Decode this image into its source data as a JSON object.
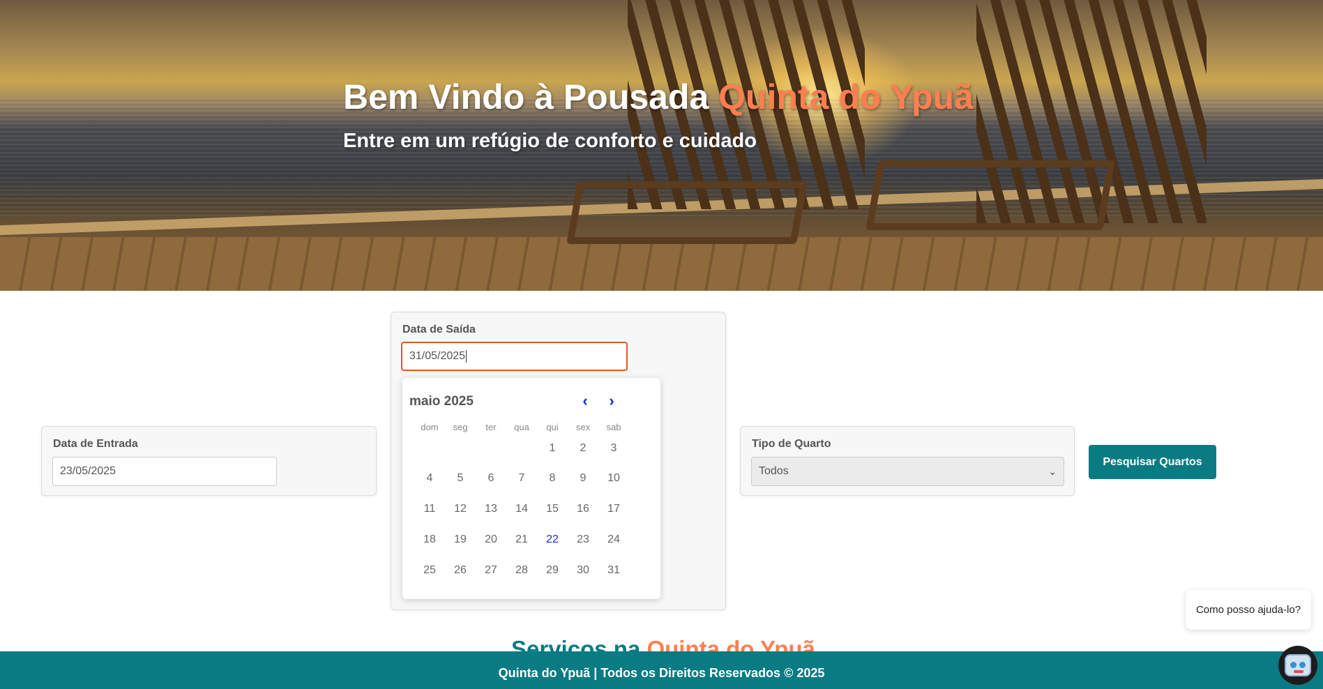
{
  "hero": {
    "title_prefix": "Bem Vindo à Pousada ",
    "title_accent": "Quinta do Ypuã",
    "subtitle": "Entre em um refúgio de conforto e cuidado"
  },
  "search": {
    "checkin": {
      "label": "Data de Entrada",
      "value": "23/05/2025"
    },
    "checkout": {
      "label": "Data de Saída",
      "value": "31/05/2025"
    },
    "room_type": {
      "label": "Tipo de Quarto",
      "selected": "Todos"
    },
    "button_label": "Pesquisar Quartos"
  },
  "datepicker": {
    "month_label": "maio 2025",
    "prev_icon": "chevron-left-icon",
    "next_icon": "chevron-right-icon",
    "weekdays": [
      "dom",
      "seg",
      "ter",
      "qua",
      "qui",
      "sex",
      "sab"
    ],
    "weeks": [
      [
        "",
        "",
        "",
        "",
        "1",
        "2",
        "3"
      ],
      [
        "4",
        "5",
        "6",
        "7",
        "8",
        "9",
        "10"
      ],
      [
        "11",
        "12",
        "13",
        "14",
        "15",
        "16",
        "17"
      ],
      [
        "18",
        "19",
        "20",
        "21",
        "22",
        "23",
        "24"
      ],
      [
        "25",
        "26",
        "27",
        "28",
        "29",
        "30",
        "31"
      ]
    ],
    "today": "22"
  },
  "services": {
    "heading_prefix": "Serviços na ",
    "heading_accent": "Quinta do Ypuã"
  },
  "chat": {
    "bubble_text": "Como posso ajuda-lo?",
    "avatar_icon": "robot-icon"
  },
  "footer": {
    "text": "Quinta do Ypuã | Todos os Direitos Reservados © 2025"
  },
  "colors": {
    "accent": "#ff7f50",
    "primary": "#0a7b83",
    "focus_border": "#e0572a",
    "today": "#1a2fd6"
  }
}
